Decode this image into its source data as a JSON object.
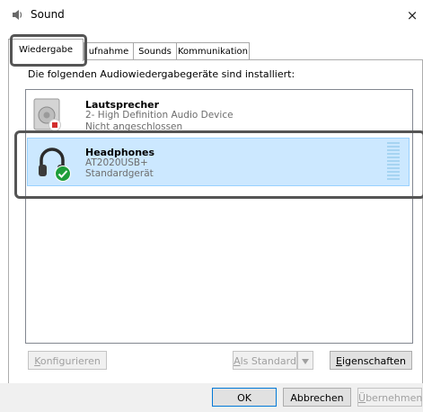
{
  "window": {
    "title": "Sound",
    "close_icon": "×",
    "title_icon": "speaker-icon"
  },
  "tabs": [
    {
      "label": "Wiedergabe",
      "selected": true
    },
    {
      "label": "ufnahme",
      "selected": false
    },
    {
      "label": "Sounds",
      "selected": false
    },
    {
      "label": "Kommunikation",
      "selected": false
    }
  ],
  "panel": {
    "intro": "Die folgenden Audiowiedergabegeräte sind installiert:"
  },
  "devices": [
    {
      "name": "Lautsprecher",
      "line1": "2- High Definition Audio Device",
      "line2": "Nicht angeschlossen",
      "icon": "speaker-icon",
      "status_icon": "disconnected-icon",
      "selected": false
    },
    {
      "name": "Headphones",
      "line1": "AT2020USB+",
      "line2": "Standardgerät",
      "icon": "headphones-icon",
      "status_icon": "checkmark-icon",
      "selected": true
    }
  ],
  "buttons": {
    "configure": {
      "prefix": "",
      "accel": "K",
      "rest": "onfigurieren"
    },
    "set_default": {
      "prefix": "",
      "accel": "A",
      "rest": "ls Standard"
    },
    "properties": {
      "prefix": "",
      "accel": "E",
      "rest": "igenschaften"
    },
    "ok": "OK",
    "cancel": "Abbrechen",
    "apply": {
      "prefix": "",
      "accel": "Ü",
      "rest": "bernehmen"
    }
  },
  "colors": {
    "selection_bg": "#cce8ff",
    "selection_border": "#99d1ff",
    "ok_border": "#0078d7",
    "check_green": "#1e9e3a",
    "annotation": "#555555"
  }
}
